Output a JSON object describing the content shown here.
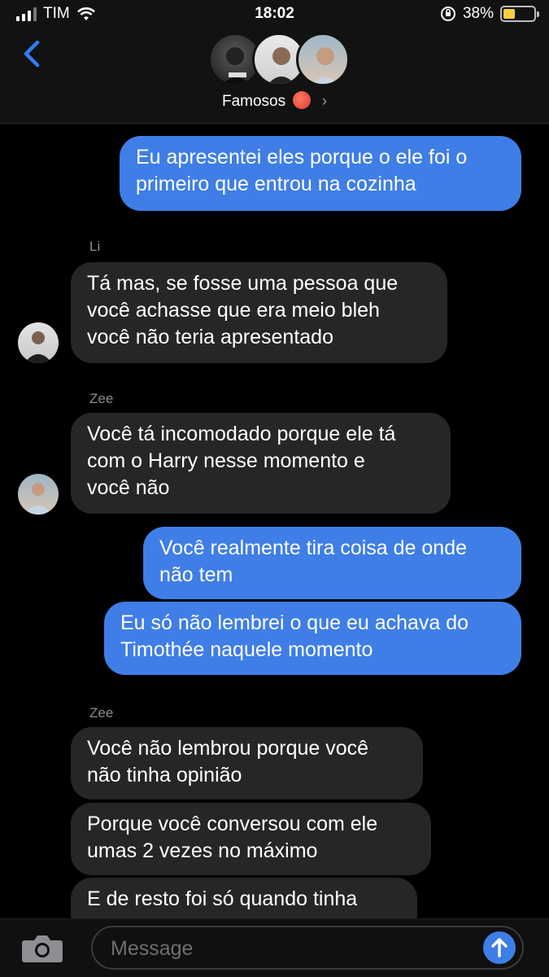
{
  "status_bar": {
    "carrier": "TIM",
    "time": "18:02",
    "battery": "38%",
    "battery_level": 0.38
  },
  "header": {
    "group_name": "Famosos",
    "avatars": [
      "avatar-1",
      "avatar-2",
      "avatar-3"
    ]
  },
  "messages": [
    {
      "type": "sent",
      "lines": [
        "Eu apresentei eles porque o ele foi o",
        "primeiro que entrou na cozinha"
      ]
    },
    {
      "type": "received",
      "sender": "Li",
      "lines": [
        "Tá mas, se fosse uma pessoa que",
        "você achasse que era meio bleh",
        "você não teria apresentado"
      ]
    },
    {
      "type": "received",
      "sender": "Zee",
      "lines": [
        "Você tá incomodado porque ele tá",
        "com o Harry nesse momento e",
        "você não"
      ]
    },
    {
      "type": "sent",
      "lines": [
        "Você realmente tira coisa de onde",
        "não tem"
      ]
    },
    {
      "type": "sent",
      "lines": [
        "Eu só não lembrei o que eu achava do",
        "Timothée naquele momento"
      ]
    },
    {
      "type": "received",
      "sender": "Zee",
      "lines": [
        "Você não lembrou porque você",
        "não tinha opinião"
      ]
    },
    {
      "type": "received",
      "lines": [
        "Porque você conversou com ele",
        "umas 2 vezes no máximo"
      ]
    },
    {
      "type": "received",
      "lines": [
        "E de resto foi só quando tinha"
      ]
    }
  ],
  "input": {
    "placeholder": "Message"
  },
  "colors": {
    "sent_bubble": "#3f7ee6",
    "received_bubble": "#262628",
    "accent": "#2f7cf6"
  }
}
